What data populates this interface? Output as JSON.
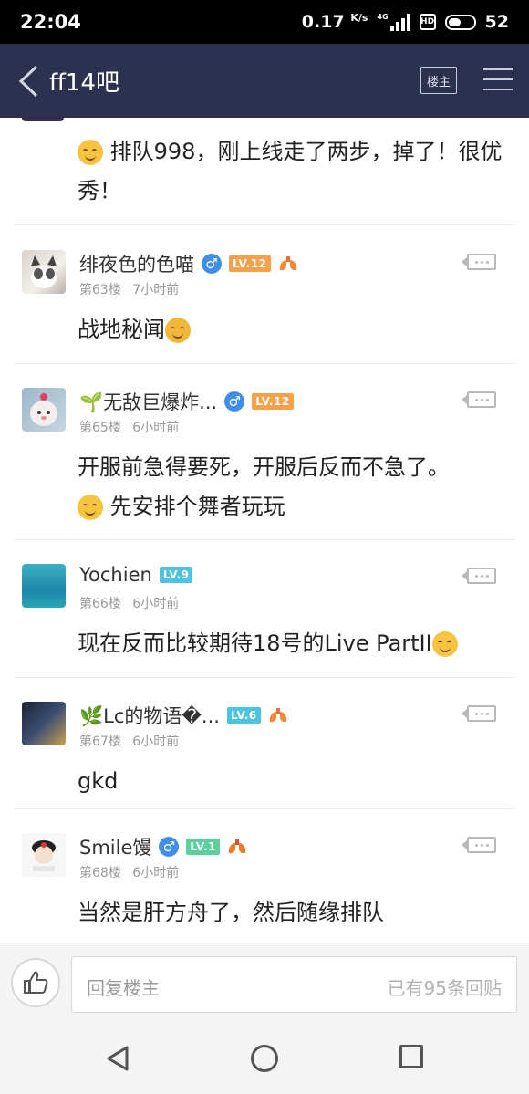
{
  "status_bar": {
    "time": "22:04",
    "speed_value": "0.17",
    "speed_unit": "K/s",
    "network": "4G",
    "hd": "HD",
    "battery": "52"
  },
  "nav": {
    "title": "ff14吧",
    "owner_button": "楼主",
    "back_icon": "back-chevron-icon",
    "menu_icon": "hamburger-icon"
  },
  "top_post": {
    "text": "排队998，刚上线走了两步，掉了！很优秀！"
  },
  "posts": [
    {
      "username": "绯夜色的色喵",
      "gender": "♂",
      "level": "LV.12",
      "level_color": "#f5a04a",
      "floor": "第63楼",
      "time": "7小时前",
      "content": "战地秘闻"
    },
    {
      "username": "🌱无敌巨爆炸...",
      "gender": "♂",
      "level": "LV.12",
      "level_color": "#f5a04a",
      "floor": "第65楼",
      "time": "6小时前",
      "content": "开服前急得要死，开服后反而不急了。",
      "content_line2": "先安排个舞者玩玩"
    },
    {
      "username": "Yochien",
      "level": "LV.9",
      "level_color": "#4cc3e0",
      "floor": "第66楼",
      "time": "6小时前",
      "content": "现在反而比较期待18号的Live PartII"
    },
    {
      "username": "🌿Lc的物语�...",
      "level": "LV.6",
      "level_color": "#4cc3e0",
      "floor": "第67楼",
      "time": "6小时前",
      "content": "gkd"
    },
    {
      "username": "Smile馒",
      "gender": "♂",
      "level": "LV.1",
      "level_color": "#5ccf9c",
      "floor": "第68楼",
      "time": "6小时前",
      "content": "当然是肝方舟了，然后随缘排队"
    }
  ],
  "reply_bar": {
    "placeholder": "回复楼主",
    "count_text": "已有95条回贴"
  },
  "colors": {
    "nav_bg": "#2d3150",
    "male": "#3f8fe8"
  }
}
